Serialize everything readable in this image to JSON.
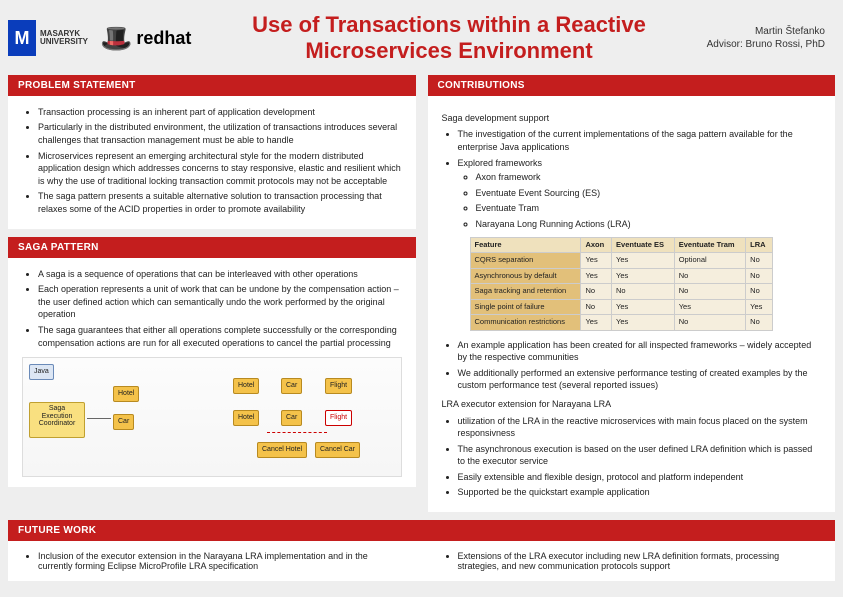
{
  "header": {
    "uniName1": "MASARYK",
    "uniName2": "UNIVERSITY",
    "redhat": "redhat",
    "title": "Use of Transactions within a Reactive Microservices Environment",
    "author": "Martin Štefanko",
    "advisor": "Advisor: Bruno Rossi, PhD"
  },
  "sections": {
    "problem": {
      "title": "PROBLEM STATEMENT",
      "bullets": [
        "Transaction processing is an inherent part of application development",
        "Particularly in the distributed environment, the utilization of transactions introduces several challenges that transaction management must be able to handle",
        "Microservices represent an emerging architectural style for the modern distributed application design which addresses concerns to stay responsive, elastic and resilient which is why the use of traditional locking transaction commit protocols may not be acceptable",
        "The saga pattern presents a suitable alternative solution to transaction processing that relaxes some of the ACID properties in order to promote availability"
      ]
    },
    "saga": {
      "title": "SAGA PATTERN",
      "bullets": [
        "A saga is a sequence of operations that can be interleaved with other operations",
        "Each operation represents a unit of work that can be undone by the compensation action – the user defined action which can semantically undo the work performed by the original operation",
        "The saga guarantees that either all operations complete successfully or the corresponding compensation actions are run for all executed operations to cancel the partial processing"
      ],
      "diagram": {
        "sec": "Saga Execution Coordinator",
        "b1": "Hotel",
        "b2": "Car",
        "b3": "Flight",
        "b4": "Hotel",
        "b5": "Car",
        "b6": "Flight",
        "c1": "Cancel Hotel",
        "c2": "Cancel Car",
        "l1": "Java",
        "l2": "Hotel",
        "l3": "Car"
      }
    },
    "contrib": {
      "title": "CONTRIBUTIONS",
      "sagaDev": "Saga development support",
      "bullets1": [
        "The investigation of the current implementations of the saga pattern available for the enterprise Java applications",
        "Explored frameworks"
      ],
      "frameworks": [
        "Axon framework",
        "Eventuate Event Sourcing (ES)",
        "Eventuate Tram",
        "Narayana Long Running Actions (LRA)"
      ],
      "table": {
        "headers": [
          "Feature",
          "Axon",
          "Eventuate ES",
          "Eventuate Tram",
          "LRA"
        ],
        "rows": [
          [
            "CQRS separation",
            "Yes",
            "Yes",
            "Optional",
            "No"
          ],
          [
            "Asynchronous by default",
            "Yes",
            "Yes",
            "No",
            "No"
          ],
          [
            "Saga tracking and retention",
            "No",
            "No",
            "No",
            "No"
          ],
          [
            "Single point of failure",
            "No",
            "Yes",
            "Yes",
            "Yes"
          ],
          [
            "Communication restrictions",
            "Yes",
            "Yes",
            "No",
            "No"
          ]
        ]
      },
      "bullets2": [
        "An example application has been created for all inspected frameworks – widely accepted by the respective communities",
        "We additionally performed an extensive performance testing of created examples by the custom performance test (several reported issues)"
      ],
      "lraHead": "LRA executor extension for Narayana LRA",
      "bullets3": [
        "utilization of the LRA in the reactive microservices with main focus placed on the system responsivness",
        "The asynchronous execution is based on the user defined LRA definition which is passed to the executor service",
        "Easily extensible and flexible design, protocol and platform independent",
        "Supported be the quickstart example application"
      ]
    },
    "future": {
      "title": "FUTURE WORK",
      "left": "Inclusion of the executor extension in the Narayana LRA implementation and in the currently forming Eclipse MicroProfile LRA specification",
      "right": "Extensions of the LRA executor including new LRA definition formats, processing strategies, and new communication protocols support"
    }
  }
}
